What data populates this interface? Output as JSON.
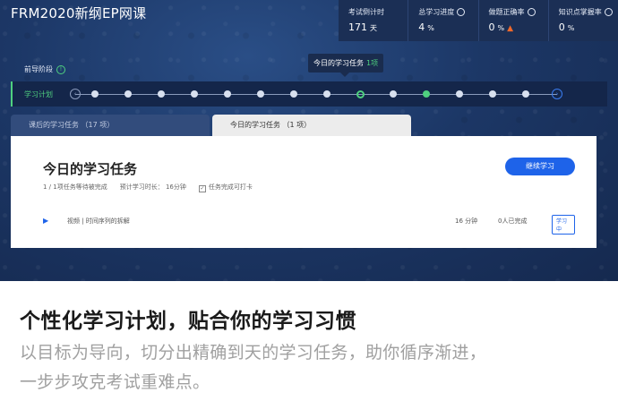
{
  "app": {
    "title": "FRM2020新纲EP网课"
  },
  "stats": [
    {
      "label": "考试倒计时",
      "value": "171",
      "unit": "天",
      "icon": "",
      "extra_icon": ""
    },
    {
      "label": "总学习进度",
      "value": "4",
      "unit": "%",
      "icon": "circle-icon",
      "extra_icon": ""
    },
    {
      "label": "做题正确率",
      "value": "0",
      "unit": "%",
      "icon": "circle-icon",
      "extra_icon": "warning-icon"
    },
    {
      "label": "知识点掌握率",
      "value": "0",
      "unit": "%",
      "icon": "circle-icon",
      "extra_icon": ""
    }
  ],
  "tooltip": {
    "text": "今日的学习任务",
    "count": "1项"
  },
  "stage": {
    "label": "前导阶段",
    "icon": "info-icon"
  },
  "plan": {
    "label": "学习计划",
    "nodes": [
      "dot",
      "dot",
      "dot",
      "dot",
      "dot",
      "dot",
      "dot",
      "dot",
      "pin",
      "dot",
      "active",
      "dot",
      "dot",
      "dot"
    ],
    "active_color": "#4fd07f"
  },
  "tabs": [
    {
      "label": "课后的学习任务 （17 项）",
      "active": false
    },
    {
      "label": "今日的学习任务 （1 项）",
      "active": true
    }
  ],
  "card": {
    "title": "今日的学习任务",
    "progress": "1 / 1项任务等待被完成",
    "estimate": "预计学习时长： 16分钟",
    "complete_note": "任务完成可打卡",
    "button_label": "继续学习",
    "accent": "#1e63e9"
  },
  "task": {
    "name": "视频 | 时间序列的拆解",
    "duration": "16 分钟",
    "done": "0人已完成",
    "badge": "学习中"
  },
  "promo": {
    "headline": "个性化学习计划，贴合你的学习习惯",
    "line1": "以目标为导向，切分出精确到天的学习任务，助你循序渐进，",
    "line2": "一步步攻克考试重难点。"
  }
}
